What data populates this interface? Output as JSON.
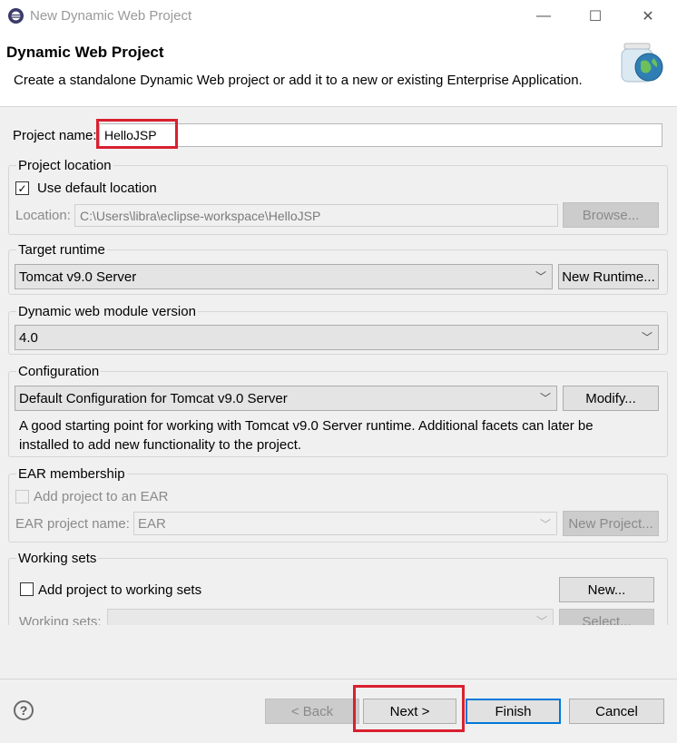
{
  "window": {
    "title": "New Dynamic Web Project",
    "minimize_glyph": "—",
    "maximize_glyph": "☐",
    "close_glyph": "✕"
  },
  "banner": {
    "title": "Dynamic Web Project",
    "description": "Create a standalone Dynamic Web project or add it to a new or existing Enterprise Application.",
    "icon": "web-project-jar-globe-icon"
  },
  "project_name": {
    "label": "Project name:",
    "value": "HelloJSP"
  },
  "project_location": {
    "group_label": "Project location",
    "use_default_label": "Use default location",
    "use_default_checked": true,
    "location_label": "Location:",
    "location_value": "C:\\Users\\libra\\eclipse-workspace\\HelloJSP",
    "browse_label": "Browse..."
  },
  "target_runtime": {
    "group_label": "Target runtime",
    "selected": "Tomcat v9.0 Server",
    "new_runtime_label": "New Runtime..."
  },
  "module_version": {
    "group_label": "Dynamic web module version",
    "selected": "4.0"
  },
  "configuration": {
    "group_label": "Configuration",
    "selected": "Default Configuration for Tomcat v9.0 Server",
    "modify_label": "Modify...",
    "description_line1": "A good starting point for working with Tomcat v9.0 Server runtime. Additional facets can later be",
    "description_line2": "installed to add new functionality to the project."
  },
  "ear": {
    "group_label": "EAR membership",
    "add_label": "Add project to an EAR",
    "add_checked": false,
    "name_label": "EAR project name:",
    "name_value": "EAR",
    "new_project_label": "New Project..."
  },
  "working_sets": {
    "group_label": "Working sets",
    "add_label": "Add project to working sets",
    "add_checked": false,
    "new_label": "New...",
    "sets_label": "Working sets:",
    "select_label": "Select..."
  },
  "footer": {
    "help_glyph": "?",
    "back_label": "< Back",
    "next_label": "Next >",
    "finish_label": "Finish",
    "cancel_label": "Cancel"
  },
  "colors": {
    "highlight": "#d9202f",
    "default_button_border": "#0078d7"
  }
}
